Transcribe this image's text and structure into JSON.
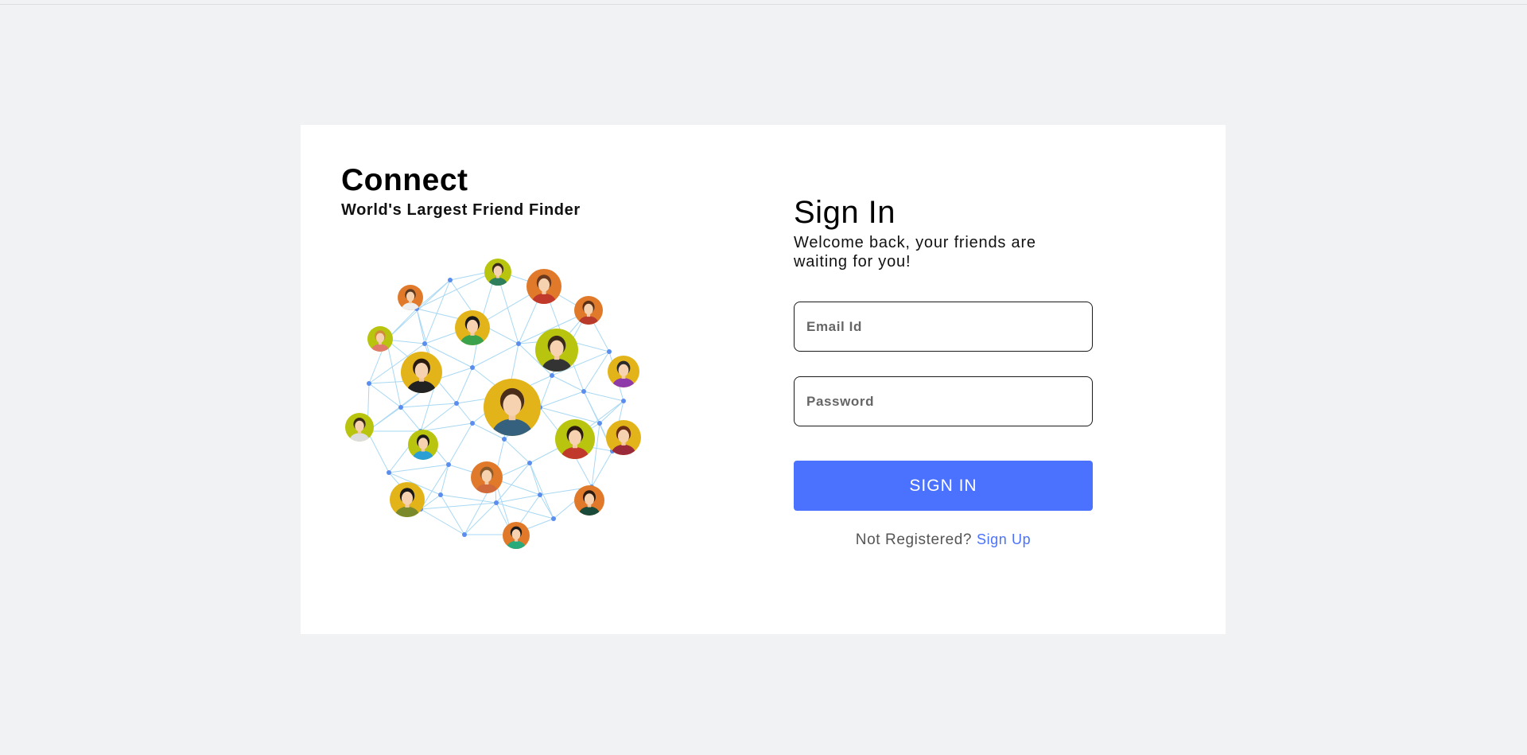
{
  "brand": {
    "title": "Connect",
    "tagline": "World's Largest Friend Finder"
  },
  "illustration": {
    "icon": "social-network-people-illustration",
    "node_color": "#5b8def",
    "line_color": "#9fd4f2"
  },
  "signin": {
    "title": "Sign In",
    "subtitle": "Welcome back, your friends are waiting for you!",
    "email_placeholder": "Email Id",
    "email_value": "",
    "password_placeholder": "Password",
    "password_value": "",
    "button_label": "SIGN IN",
    "not_registered_text": "Not Registered?",
    "signup_link_label": "Sign Up"
  },
  "colors": {
    "accent": "#4a72ff",
    "page_background": "#f1f2f4",
    "card_background": "#ffffff"
  }
}
